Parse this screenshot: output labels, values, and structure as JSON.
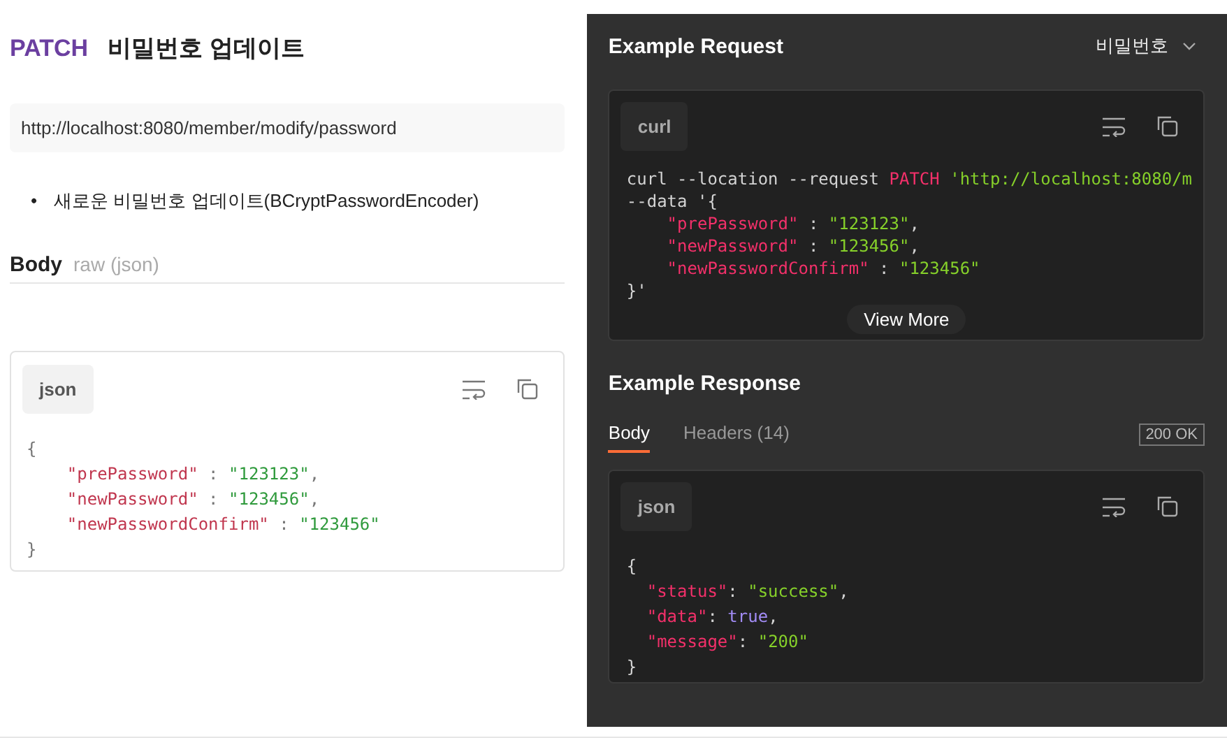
{
  "endpoint": {
    "method": "PATCH",
    "title": "비밀번호 업데이트",
    "url": "http://localhost:8080/member/modify/password",
    "notes": [
      {
        "marker": "•",
        "text": "새로운 비밀번호 업데이트(BCryptPasswordEncoder)"
      }
    ]
  },
  "body": {
    "label": "Body",
    "type": "raw (json)",
    "language": "json",
    "code": [
      [
        {
          "kind": "punct",
          "text": "{"
        }
      ],
      [
        {
          "kind": "key",
          "text": "    \"prePassword\""
        },
        {
          "kind": "punct",
          "text": " : "
        },
        {
          "kind": "string",
          "text": "\"123123\""
        },
        {
          "kind": "punct",
          "text": ","
        }
      ],
      [
        {
          "kind": "key",
          "text": "    \"newPassword\""
        },
        {
          "kind": "punct",
          "text": " : "
        },
        {
          "kind": "string",
          "text": "\"123456\""
        },
        {
          "kind": "punct",
          "text": ","
        }
      ],
      [
        {
          "kind": "key",
          "text": "    \"newPasswordConfirm\""
        },
        {
          "kind": "punct",
          "text": " : "
        },
        {
          "kind": "string",
          "text": "\"123456\""
        }
      ],
      [
        {
          "kind": "punct",
          "text": "}"
        }
      ]
    ]
  },
  "example_request": {
    "title": "Example Request",
    "selector": "비밀번호",
    "language": "curl",
    "view_more": "View More",
    "code": [
      [
        {
          "kind": "plain",
          "text": "curl --location --request "
        },
        {
          "kind": "keyword",
          "text": "PATCH"
        },
        {
          "kind": "string",
          "text": " 'http://localhost:8080/m"
        }
      ],
      [
        {
          "kind": "plain",
          "text": "--data '{"
        }
      ],
      [
        {
          "kind": "key",
          "text": "    \"prePassword\""
        },
        {
          "kind": "plain",
          "text": " : "
        },
        {
          "kind": "string",
          "text": "\"123123\""
        },
        {
          "kind": "plain",
          "text": ","
        }
      ],
      [
        {
          "kind": "key",
          "text": "    \"newPassword\""
        },
        {
          "kind": "plain",
          "text": " : "
        },
        {
          "kind": "string",
          "text": "\"123456\""
        },
        {
          "kind": "plain",
          "text": ","
        }
      ],
      [
        {
          "kind": "key",
          "text": "    \"newPasswordConfirm\""
        },
        {
          "kind": "plain",
          "text": " : "
        },
        {
          "kind": "string",
          "text": "\"123456\""
        }
      ],
      [
        {
          "kind": "plain",
          "text": "}'"
        }
      ]
    ]
  },
  "example_response": {
    "title": "Example Response",
    "status": "200 OK",
    "language": "json",
    "tabs": [
      {
        "label": "Body",
        "selected": true
      },
      {
        "label": "Headers (14)",
        "selected": false
      }
    ],
    "code": [
      [
        {
          "kind": "plain",
          "text": "{"
        }
      ],
      [
        {
          "kind": "key",
          "text": "  \"status\""
        },
        {
          "kind": "plain",
          "text": ": "
        },
        {
          "kind": "string",
          "text": "\"success\""
        },
        {
          "kind": "plain",
          "text": ","
        }
      ],
      [
        {
          "kind": "key",
          "text": "  \"data\""
        },
        {
          "kind": "plain",
          "text": ": "
        },
        {
          "kind": "bool",
          "text": "true"
        },
        {
          "kind": "plain",
          "text": ","
        }
      ],
      [
        {
          "kind": "key",
          "text": "  \"message\""
        },
        {
          "kind": "plain",
          "text": ": "
        },
        {
          "kind": "string",
          "text": "\"200\""
        }
      ],
      [
        {
          "kind": "plain",
          "text": "}"
        }
      ]
    ]
  }
}
